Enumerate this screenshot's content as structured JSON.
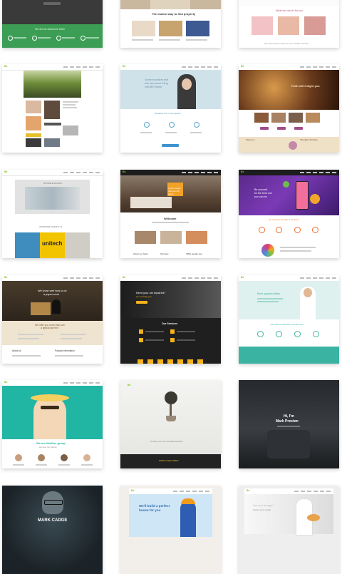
{
  "page": {
    "background": "#ffffff",
    "accent": "#83c11f"
  },
  "logo_text": "Be",
  "cards": {
    "c1": {
      "tagline": "We are an awesome team",
      "button": "Join us"
    },
    "c2": {
      "headline": "The easiest way to find property"
    },
    "c3": {
      "headline": "What we can do for you",
      "tagline": "We know what it takes for your health & beauty"
    },
    "c5": {
      "headline1": "Some excellent text",
      "headline2": "lets see some thing",
      "headline3": "with BeTheme",
      "subhead": "Excellent text. Lorem ipsum"
    },
    "c6": {
      "headline": "Faith will enlight you",
      "section1": "Welcome",
      "section2": "Thoughts & Poetry"
    },
    "c7": {
      "label1": "NOTABLE WORKS",
      "label2": "AWESOME WORKS '14",
      "brand": "unitech"
    },
    "c8": {
      "headline1": "Luxury space",
      "headline2": "that you will",
      "headline3": "adore",
      "title": "Welcome",
      "col1": "About our hotel",
      "col2": "Services",
      "col3": "What people say"
    },
    "c9": {
      "headline1": "Be yourself,",
      "headline2": "be the best one",
      "headline3": "you can be",
      "subhead": "As a search term Be is the best"
    },
    "c10": {
      "headline1": "We know well how to do",
      "headline2": "a paper work",
      "sub1": "We offer you more than just",
      "sub2": "a typical law firm",
      "col1": "About us",
      "col2": "Popular information"
    },
    "c11": {
      "headline1": "Need your car repaired?",
      "headline2": "we can help you",
      "title": "Our Services"
    },
    "c12": {
      "headline": "Best opportunities",
      "subhead": "The highest standard of health care"
    },
    "c13": {
      "headline1": "We are Muffins group",
      "headline2": "we love our clients"
    },
    "c14": {
      "caption": "Create your own beautiful website",
      "footer": "WATCH THE VIDEO"
    },
    "c15": {
      "headline1": "Hi, I'm",
      "headline2": "Mark Preston"
    },
    "c16": {
      "name": "MARK CADGE"
    },
    "c17": {
      "headline1": "We'll build a perfect",
      "headline2": "house for you"
    },
    "c18": {
      "headline1": "Are you hungry?",
      "headline2": "Great, come inside"
    }
  }
}
